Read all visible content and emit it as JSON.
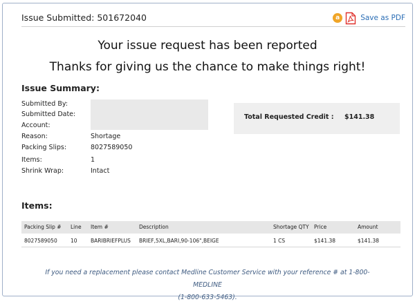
{
  "header": {
    "title": "Issue Submitted: 501672040",
    "badge": "a",
    "pdf_icon": "pdf-file-icon",
    "save_pdf_label": "Save as PDF"
  },
  "headline": {
    "line1": "Your issue request has been reported",
    "line2": "Thanks for giving us the chance to make things right!"
  },
  "summary": {
    "title": "Issue Summary:",
    "fields": {
      "submitted_by_label": "Submitted By:",
      "submitted_date_label": "Submitted Date:",
      "account_label": "Account:",
      "reason_label": "Reason:",
      "reason_value": "Shortage",
      "packing_slips_label": "Packing Slips:",
      "packing_slips_value": "8027589050",
      "items_label": "Items:",
      "items_value": "1",
      "shrink_wrap_label": "Shrink Wrap:",
      "shrink_wrap_value": "Intact"
    },
    "credit": {
      "label": "Total Requested Credit :",
      "value": "$141.38"
    }
  },
  "items": {
    "title": "Items:",
    "columns": [
      "Packing Slip #",
      "Line",
      "Item #",
      "Description",
      "Shortage QTY",
      "Price",
      "Amount"
    ],
    "rows": [
      [
        "8027589050",
        "10",
        "BARIBRIEFPLUS",
        "BRIEF,5XL,BARI,90-106\",BEIGE",
        "1 CS",
        "$141.38",
        "$141.38"
      ]
    ]
  },
  "footer": {
    "line1": "If you need a replacement please contact Medline Customer Service with your reference # at 1-800-MEDLINE",
    "line2": "(1-800-633-5463)."
  },
  "colors": {
    "link": "#2a6db5",
    "badge": "#f0a528",
    "pdf_red": "#e0312c",
    "footer_text": "#3d5a80"
  }
}
